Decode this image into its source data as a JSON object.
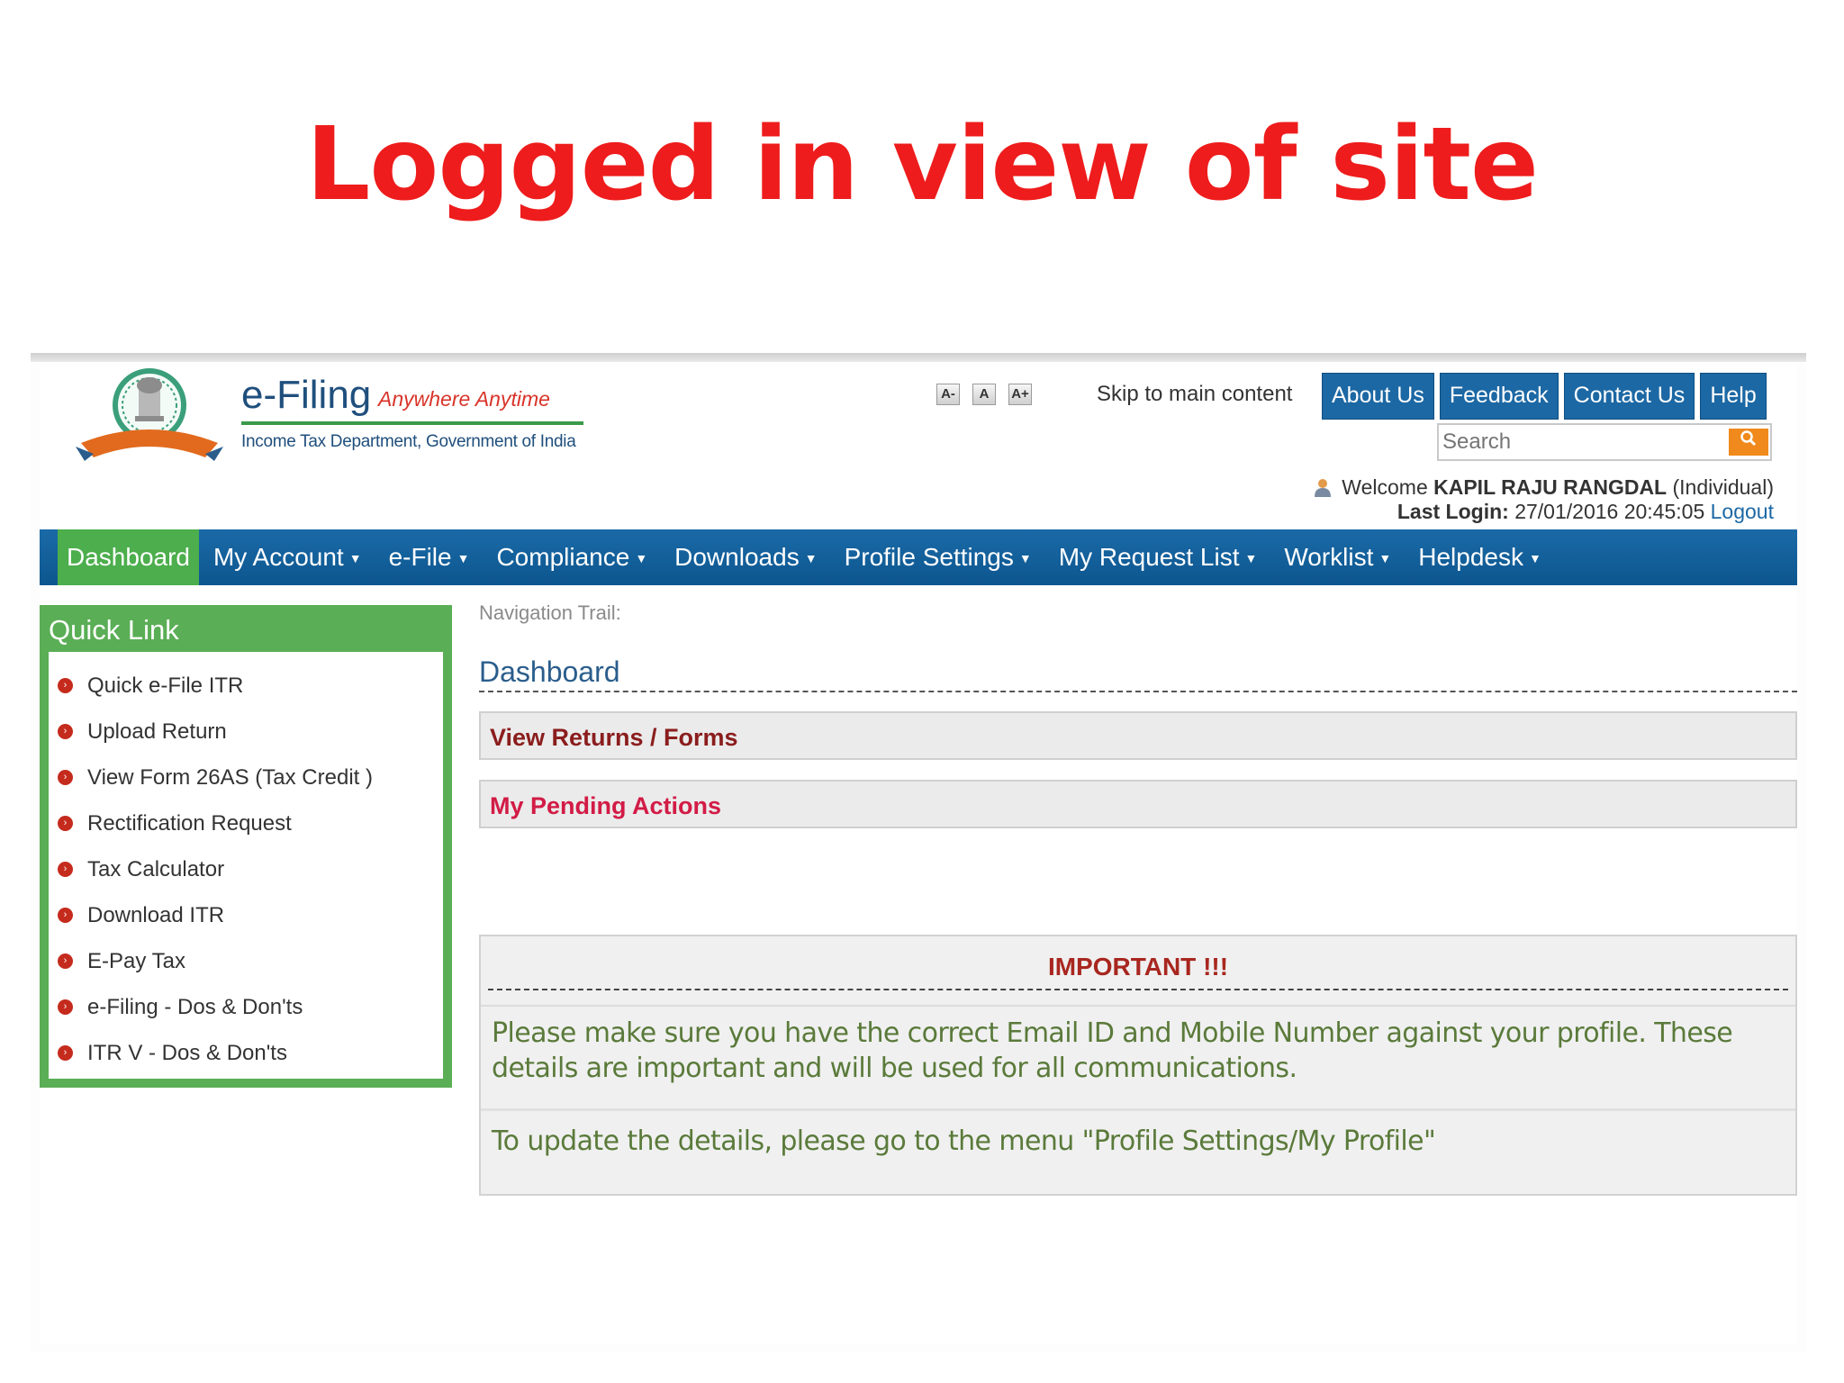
{
  "slide_title": "Logged in view of site",
  "header": {
    "brand_title": "e-Filing",
    "brand_tagline": "Anywhere Anytime",
    "brand_subtitle": "Income Tax Department, Government of India",
    "font_controls": [
      "A-",
      "A",
      "A+"
    ],
    "skip_link": "Skip to main content",
    "top_links": [
      "About Us",
      "Feedback",
      "Contact Us",
      "Help"
    ],
    "search_placeholder": "Search",
    "welcome_prefix": "Welcome",
    "user_name": "KAPIL RAJU RANGDAL",
    "user_type": "(Individual)",
    "last_login_label": "Last Login:",
    "last_login_value": "27/01/2016 20:45:05",
    "logout_label": "Logout"
  },
  "main_nav": {
    "items": [
      {
        "label": "Dashboard",
        "active": true
      },
      {
        "label": "My Account"
      },
      {
        "label": "e-File"
      },
      {
        "label": "Compliance"
      },
      {
        "label": "Downloads"
      },
      {
        "label": "Profile Settings"
      },
      {
        "label": "My Request List"
      },
      {
        "label": "Worklist"
      },
      {
        "label": "Helpdesk"
      }
    ]
  },
  "quick_link": {
    "title": "Quick Link",
    "items": [
      "Quick e-File ITR",
      "Upload Return",
      "View Form 26AS (Tax Credit )",
      "Rectification Request",
      "Tax Calculator",
      "Download ITR",
      "E-Pay Tax",
      "e-Filing - Dos & Don'ts",
      "ITR V - Dos & Don'ts"
    ]
  },
  "content": {
    "nav_trail": "Navigation Trail:",
    "heading": "Dashboard",
    "panel_view_returns": "View Returns / Forms",
    "panel_pending": "My Pending Actions",
    "important_title": "IMPORTANT !!!",
    "important_message": "Please make sure you have the correct Email ID and Mobile Number against your profile. These details are important and will be used for all communications.",
    "important_update": "To update the details, please go to the menu \"Profile Settings/My Profile\""
  },
  "colors": {
    "title_red": "#ee1c1c",
    "nav_blue": "#1a6aa7",
    "active_green": "#4cae4c",
    "quicklink_green": "#5aae55",
    "bullet_red": "#c52b1d"
  }
}
